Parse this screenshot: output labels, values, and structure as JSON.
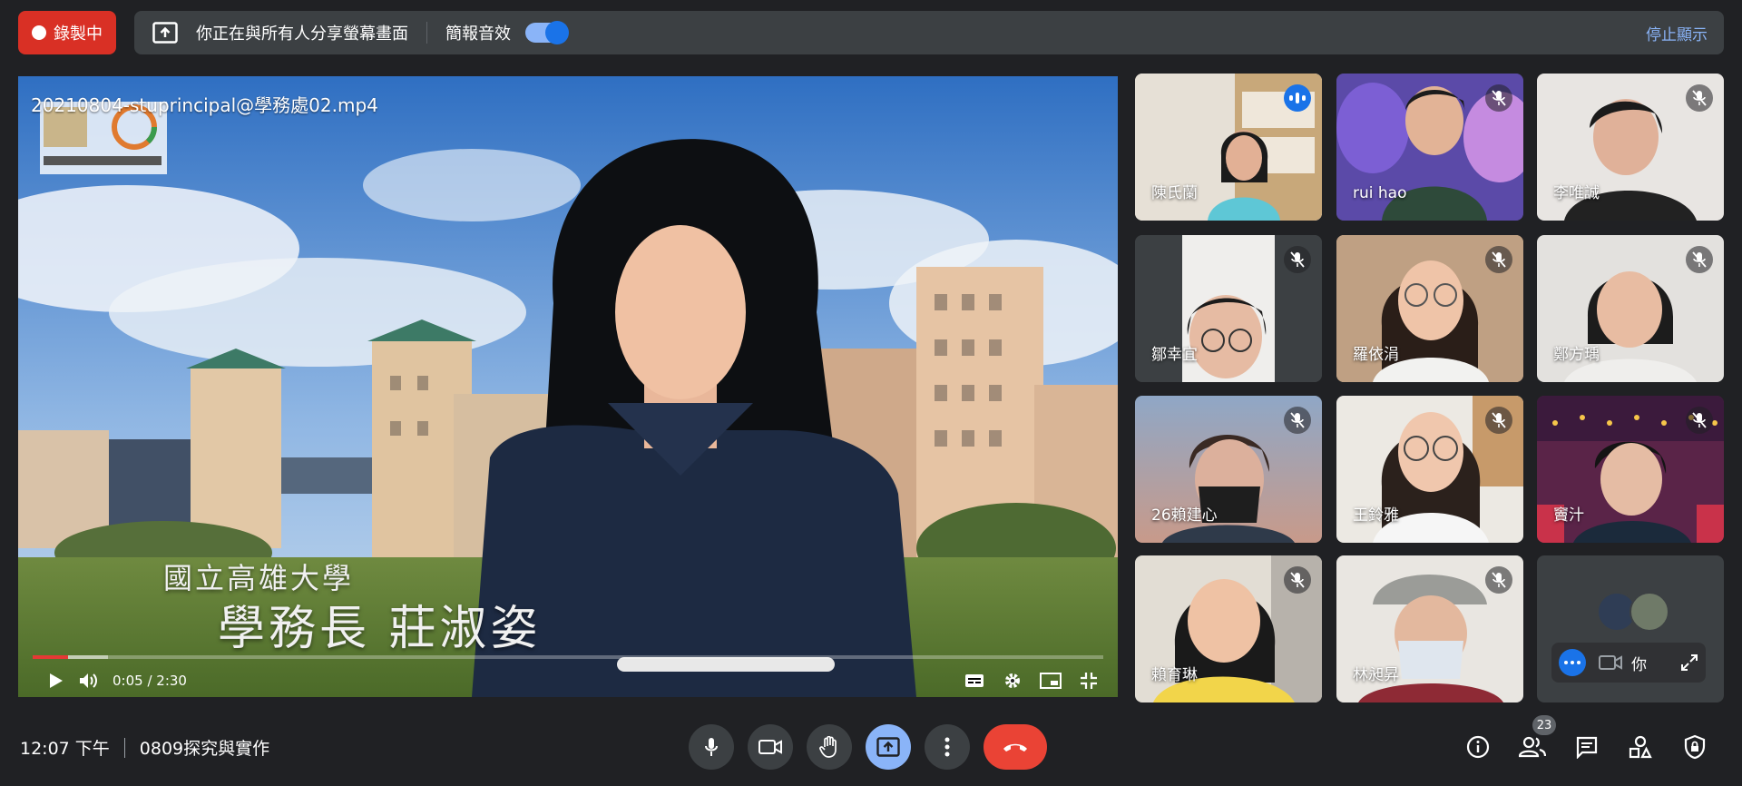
{
  "recording": {
    "label": "錄製中"
  },
  "share_banner": {
    "text": "你正在與所有人分享螢幕畫面",
    "audio_label": "簡報音效",
    "audio_enabled": true,
    "stop_label": "停止顯示"
  },
  "main_video": {
    "filename": "20210804-stuprincipal@學務處02.mp4",
    "caption_line1": "國立高雄大學",
    "caption_line2": "學務長 莊淑姿",
    "time": "0:05 / 2:30",
    "progress_fraction": 0.033,
    "buffer_fraction": 0.07
  },
  "participants": [
    {
      "name": "陳氏蘭",
      "status": "speaking"
    },
    {
      "name": "rui hao",
      "status": "muted"
    },
    {
      "name": "李唯誠",
      "status": "muted"
    },
    {
      "name": "鄒幸宜",
      "status": "muted"
    },
    {
      "name": "羅依涓",
      "status": "muted"
    },
    {
      "name": "鄭方瑀",
      "status": "muted"
    },
    {
      "name": "26賴建心",
      "status": "muted"
    },
    {
      "name": "王鈴雅",
      "status": "muted"
    },
    {
      "name": "竇汁",
      "status": "muted"
    },
    {
      "name": "賴育琳",
      "status": "muted"
    },
    {
      "name": "林昶昇",
      "status": "muted"
    }
  ],
  "self_tile": {
    "you_label": "你"
  },
  "meeting": {
    "time": "12:07 下午",
    "name": "0809探究與實作"
  },
  "people_count": "23",
  "colors": {
    "record_red": "#d93025",
    "accent_blue": "#8ab4f8",
    "hangup_red": "#ea4335",
    "panel": "#3c4043"
  }
}
